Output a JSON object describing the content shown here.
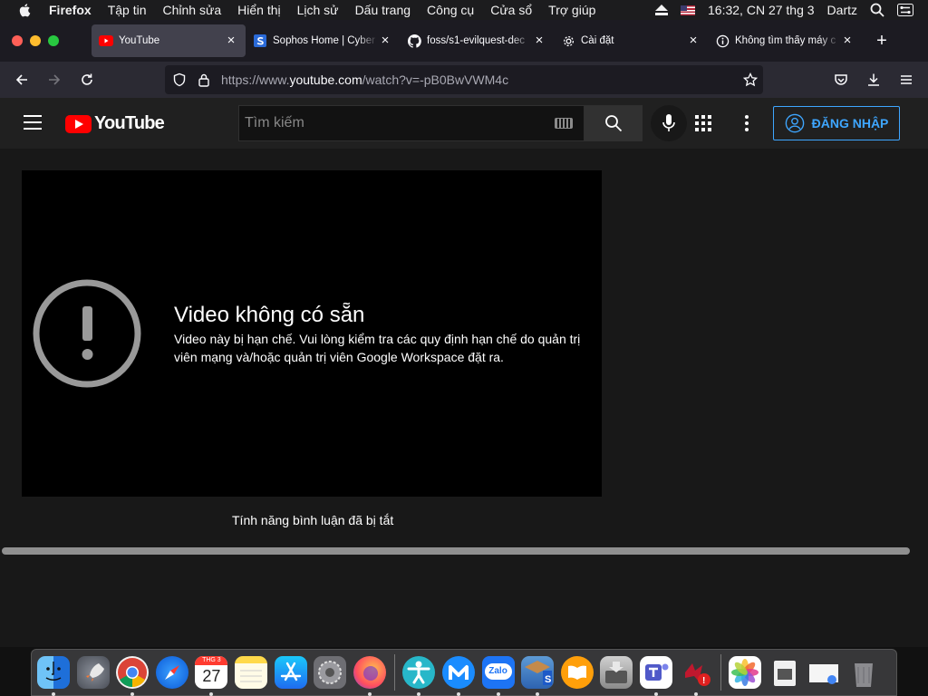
{
  "menubar": {
    "app_name": "Firefox",
    "menus": [
      "Tập tin",
      "Chỉnh sửa",
      "Hiển thị",
      "Lịch sử",
      "Dấu trang",
      "Công cụ",
      "Cửa sổ",
      "Trợ giúp"
    ],
    "clock": "16:32, CN 27 thg 3",
    "user": "Dartz"
  },
  "browser": {
    "tabs": [
      {
        "title": "YouTube",
        "icon": "youtube-icon",
        "active": true
      },
      {
        "title": "Sophos Home | Cyber",
        "icon": "sophos-icon",
        "active": false
      },
      {
        "title": "foss/s1-evilquest-dec",
        "icon": "github-icon",
        "active": false
      },
      {
        "title": "Cài đặt",
        "icon": "gear-icon",
        "active": false
      },
      {
        "title": "Không tìm thấy máy c",
        "icon": "info-icon",
        "active": false
      }
    ],
    "url_prefix": "https://www.",
    "url_domain": "youtube.com",
    "url_rest": "/watch?v=-pB0BwVWM4c"
  },
  "youtube": {
    "logo_text": "YouTube",
    "search_placeholder": "Tìm kiếm",
    "signin_label": "ĐĂNG NHẬP",
    "error_title": "Video không có sẵn",
    "error_message": "Video này bị hạn chế. Vui lòng kiểm tra các quy định hạn chế do quản trị viên mạng và/hoặc quản trị viên Google Workspace đặt ra.",
    "comments_disabled": "Tính năng bình luận đã bị tắt"
  },
  "dock": {
    "calendar_month": "THG 3",
    "calendar_day": "27",
    "apps": [
      "finder",
      "launchpad",
      "chrome",
      "safari",
      "calendar",
      "notes",
      "app-store",
      "system-preferences",
      "firefox",
      "accessibility-app",
      "malwarebytes",
      "zalo",
      "sophos",
      "books",
      "disk-utility",
      "teams",
      "app-with-badge",
      "photos",
      "preview",
      "screenshot",
      "trash"
    ]
  }
}
